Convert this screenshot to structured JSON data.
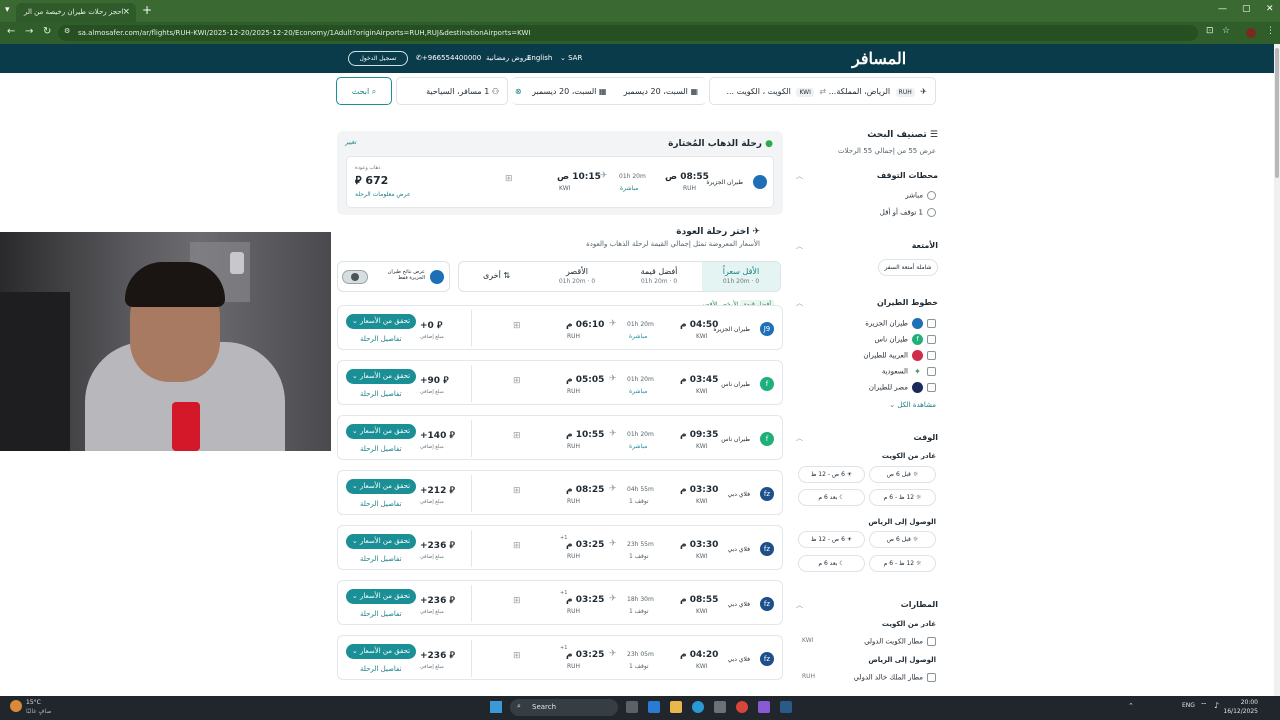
{
  "browser": {
    "tab_title": "احجز رحلات طيران رخيصة من الر",
    "url": "sa.almosafer.com/ar/flights/RUH-KWI/2025-12-20/2025-12-20/Economy/1Adult?originAirports=RUH,RUJ&destinationAirports=KWI"
  },
  "header": {
    "logo": "المسافر",
    "currency": "SAR",
    "language": "English",
    "offers": "عروض رمضانية",
    "phone": "+966554400000",
    "login": "تسجيل الدخول"
  },
  "search": {
    "origin": "الرياض، المملكة...",
    "origin_code": "RUH",
    "destination": "الكويت ، الكويت ...",
    "destination_code": "KWI",
    "depart_date": "السبت، 20 ديسمبر",
    "return_date": "السبت، 20 ديسمبر",
    "passengers": "1 مسافر، السياحية",
    "search_btn": "ابحث"
  },
  "filters": {
    "title": "تصنيف البحث",
    "subtitle": "عرض 55 من إجمالي 55 الرحلات",
    "stops": {
      "title": "محطات التوقف",
      "options": [
        "مباشر",
        "1 توقف أو أقل"
      ]
    },
    "baggage": {
      "title": "الأمتعة",
      "chip": "شاملة أمتعة السفر"
    },
    "airlines": {
      "title": "خطوط الطيران",
      "options": [
        {
          "name": "طيران الجزيرة",
          "color": "#1d6fb8"
        },
        {
          "name": "طيران ناس",
          "color": "#1fb07a"
        },
        {
          "name": "العربية للطيران",
          "color": "#d12a4a"
        },
        {
          "name": "السعودية",
          "color": "#2b9a6a"
        },
        {
          "name": "مصر للطيران",
          "color": "#1b2a5a"
        }
      ],
      "show_all": "مشاهدة الكل"
    },
    "time": {
      "title": "الوقت",
      "depart_title": "غادر من الكويت",
      "depart_chips": [
        "قبل 6 ص",
        "6 ص - 12 ظ",
        "12 ظ - 6 م",
        "بعد 6 م"
      ],
      "arrive_title": "الوصول إلى الرياض",
      "arrive_chips": [
        "قبل 6 ص",
        "6 ص - 12 ظ",
        "12 ظ - 6 م",
        "بعد 6 م"
      ]
    },
    "airports": {
      "title": "المطارات",
      "depart_title": "غادر من الكويت",
      "depart_airport": "مطار الكويت الدولي",
      "depart_code": "KWI",
      "arrive_title": "الوصول إلى الرياض",
      "arrive_airport": "مطار الملك خالد الدولي",
      "arrive_code": "RUH"
    }
  },
  "outbound": {
    "title": "رحلة الذهاب المُختارة",
    "change": "تغيير",
    "airline": "طيران الجزيرة",
    "dep_time": "08:55 ص",
    "dep_code": "RUH",
    "duration": "01h 20m",
    "stops": "مباشرة",
    "arr_time": "10:15 ص",
    "arr_code": "KWI",
    "price_label": "ذهاب وعودة",
    "price": "672",
    "details": "عرض معلومات الرحلة"
  },
  "return_section": {
    "title": "اختر رحلة العودة",
    "subtitle": "الأسعار المعروضة تمثل إجمالي القيمة لرحلة الذهاب والعودة",
    "toggle_label": "عرض نتائج طيران الجزيرة فقط",
    "sort_tabs": [
      {
        "label": "الأقل سعراً",
        "meta": "01h 20m  · 0"
      },
      {
        "label": "أفضل قيمة",
        "meta": "01h 20m  · 0"
      },
      {
        "label": "الأقصر",
        "meta": "01h 20m  · 0"
      },
      {
        "label": "أخرى",
        "meta": ""
      }
    ],
    "tags": [
      "أفضل قيمة",
      "الأرخص",
      "الأقصر"
    ]
  },
  "flights": [
    {
      "airline": "طيران الجزيرة",
      "logo_color": "#1d6fb8",
      "logo": "J9",
      "dep": "04:50 م",
      "dep_code": "KWI",
      "dur": "01h 20m",
      "stops": "مباشرة",
      "arr": "06:10 م",
      "arr_code": "RUH",
      "plus": "",
      "price": "+0",
      "price_lab": "مبلغ إضافي"
    },
    {
      "airline": "طيران ناس",
      "logo_color": "#1fb07a",
      "logo": "f",
      "dep": "03:45 م",
      "dep_code": "KWI",
      "dur": "01h 20m",
      "stops": "مباشرة",
      "arr": "05:05 م",
      "arr_code": "RUH",
      "plus": "",
      "price": "+90",
      "price_lab": "مبلغ إضافي"
    },
    {
      "airline": "طيران ناس",
      "logo_color": "#1fb07a",
      "logo": "f",
      "dep": "09:35 م",
      "dep_code": "KWI",
      "dur": "01h 20m",
      "stops": "مباشرة",
      "arr": "10:55 م",
      "arr_code": "RUH",
      "plus": "",
      "price": "+140",
      "price_lab": "مبلغ إضافي"
    },
    {
      "airline": "فلاي دبي",
      "logo_color": "#1d4f8a",
      "logo": "fz",
      "dep": "03:30 م",
      "dep_code": "KWI",
      "dur": "04h 55m",
      "stops": "1 توقف",
      "arr": "08:25 م",
      "arr_code": "RUH",
      "plus": "",
      "price": "+212",
      "price_lab": "مبلغ إضافي"
    },
    {
      "airline": "فلاي دبي",
      "logo_color": "#1d4f8a",
      "logo": "fz",
      "dep": "03:30 م",
      "dep_code": "KWI",
      "dur": "23h 55m",
      "stops": "1 توقف",
      "arr": "03:25 م",
      "arr_code": "RUH",
      "plus": "+1",
      "price": "+236",
      "price_lab": "مبلغ إضافي"
    },
    {
      "airline": "فلاي دبي",
      "logo_color": "#1d4f8a",
      "logo": "fz",
      "dep": "08:55 م",
      "dep_code": "KWI",
      "dur": "18h 30m",
      "stops": "1 توقف",
      "arr": "03:25 م",
      "arr_code": "RUH",
      "plus": "+1",
      "price": "+236",
      "price_lab": "مبلغ إضافي"
    },
    {
      "airline": "فلاي دبي",
      "logo_color": "#1d4f8a",
      "logo": "fz",
      "dep": "04:20 م",
      "dep_code": "KWI",
      "dur": "23h 05m",
      "stops": "1 توقف",
      "arr": "03:25 م",
      "arr_code": "RUH",
      "plus": "+1",
      "price": "+236",
      "price_lab": "مبلغ إضافي"
    }
  ],
  "card_labels": {
    "check": "تحقق من الأسعار",
    "details": "تفاصيل الرحلة"
  },
  "taskbar": {
    "weather_temp": "15°C",
    "weather_desc": "صافٍ غالبًا",
    "search": "Search",
    "time": "20:00",
    "date": "16/12/2025",
    "lang": "ENG"
  }
}
